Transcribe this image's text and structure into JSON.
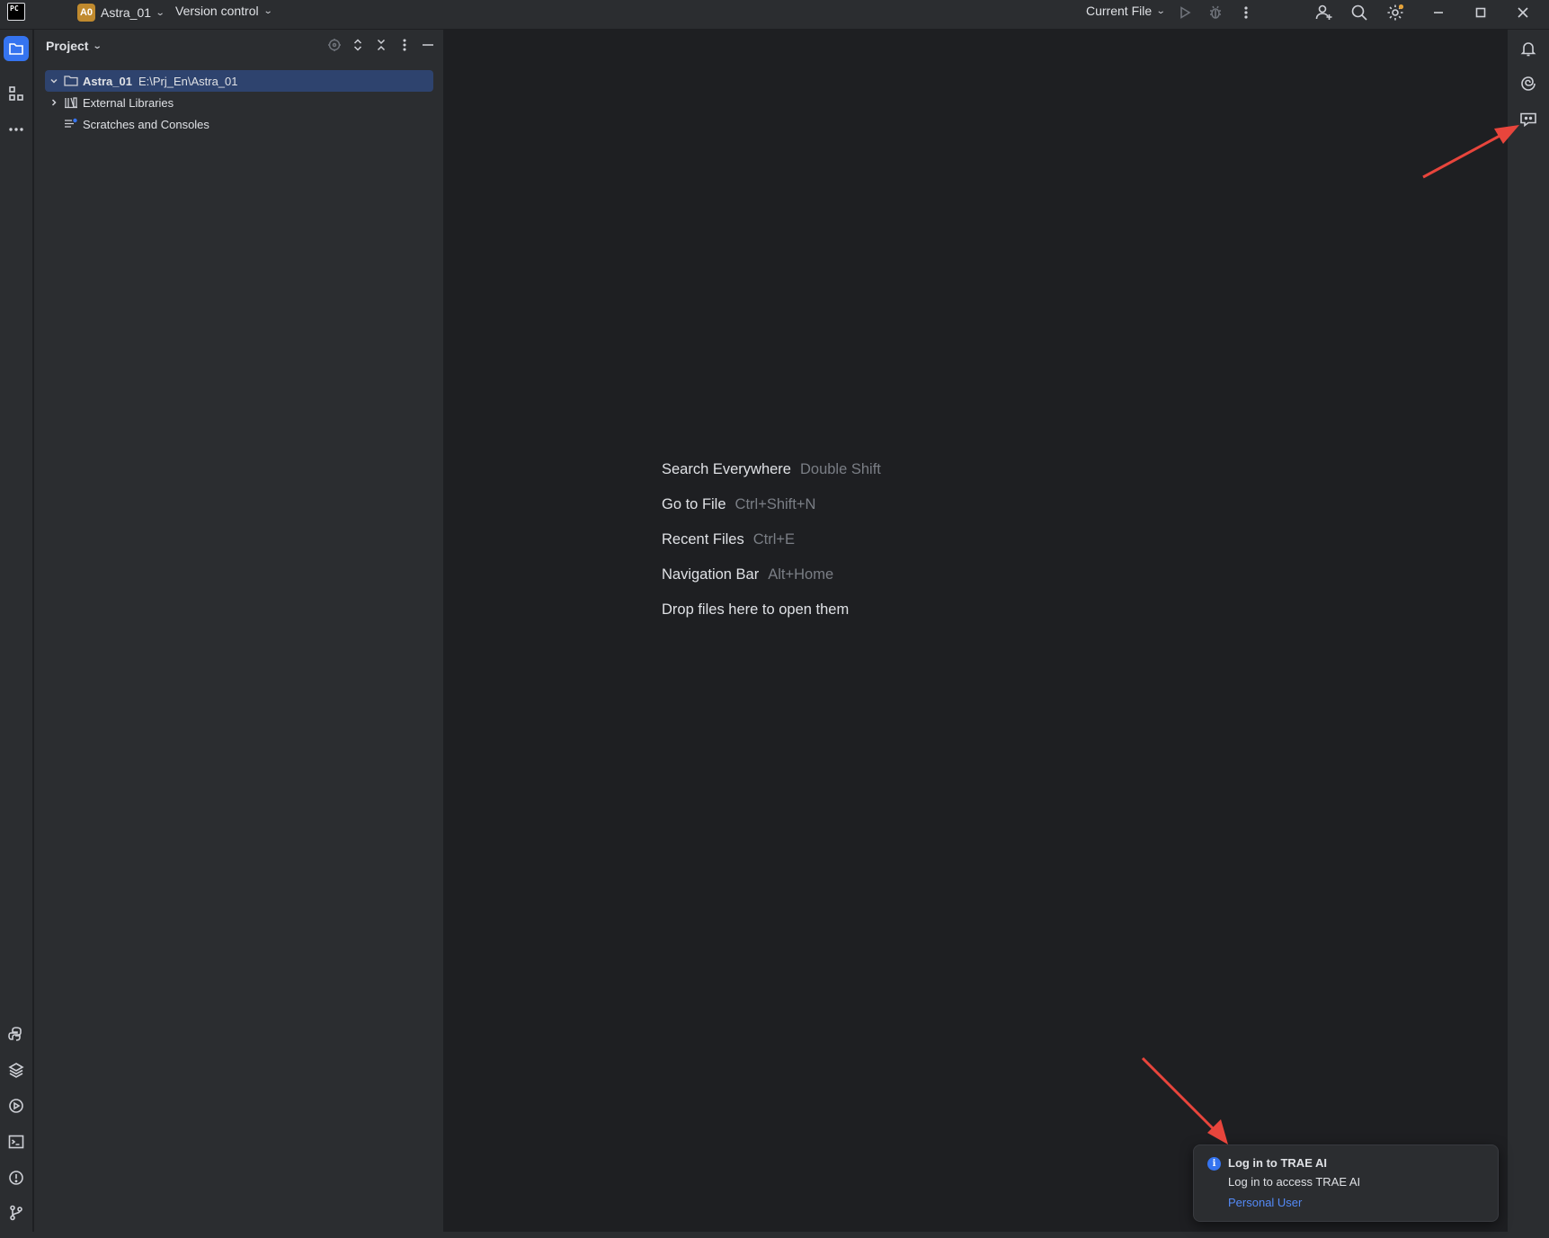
{
  "titlebar": {
    "logo_text": "PC",
    "project_badge": "A0",
    "project_name": "Astra_01",
    "vcs_label": "Version control",
    "run_config": "Current File"
  },
  "project_panel": {
    "title": "Project",
    "tree": [
      {
        "name": "Astra_01",
        "path": "E:\\Prj_En\\Astra_01"
      },
      {
        "name": "External Libraries"
      },
      {
        "name": "Scratches and Consoles"
      }
    ]
  },
  "editor": {
    "hints": [
      {
        "label": "Search Everywhere",
        "key": "Double Shift"
      },
      {
        "label": "Go to File",
        "key": "Ctrl+Shift+N"
      },
      {
        "label": "Recent Files",
        "key": "Ctrl+E"
      },
      {
        "label": "Navigation Bar",
        "key": "Alt+Home"
      },
      {
        "label": "Drop files here to open them",
        "key": ""
      }
    ]
  },
  "notification": {
    "title": "Log in to TRAE AI",
    "body": "Log in to access TRAE AI",
    "link": "Personal User"
  },
  "colors": {
    "accent": "#3574f0",
    "selection": "#2e436e",
    "panel_bg": "#2b2d30",
    "editor_bg": "#1e1f22",
    "annotation_arrow": "#e8453c",
    "badge": "#c08a2e"
  }
}
